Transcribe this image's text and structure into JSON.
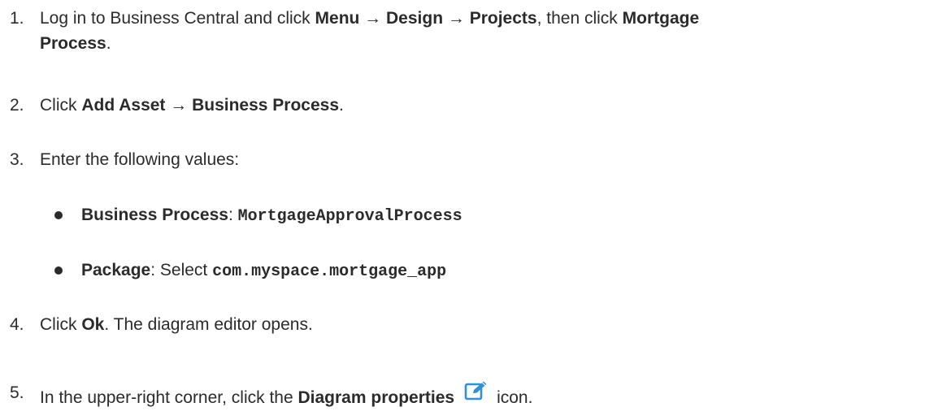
{
  "steps": [
    {
      "num": "1.",
      "text_a": "Log in to Business Central and click ",
      "menu": "Menu",
      "arrow1": " → ",
      "design": "Design",
      "arrow2": " → ",
      "projects": "Projects",
      "text_b": ", then click ",
      "mortgage": "Mortgage",
      "process": "Process",
      "text_c": "."
    },
    {
      "num": "2.",
      "text_a": "Click ",
      "add_asset": "Add Asset",
      "arrow": " → ",
      "business_process": "Business Process",
      "text_b": "."
    },
    {
      "num": "3.",
      "text_a": "Enter the following values:",
      "bullets": [
        {
          "label": "Business Process",
          "sep": ": ",
          "value": "MortgageApprovalProcess"
        },
        {
          "label": "Package",
          "sep": ": Select ",
          "value": "com.myspace.mortgage_app"
        }
      ]
    },
    {
      "num": "4.",
      "text_a": "Click ",
      "ok": "Ok",
      "text_b": ". The diagram editor opens."
    },
    {
      "num": "5.",
      "text_a": "In the upper-right corner, click the ",
      "diagram_properties": "Diagram properties",
      "icon_name": "edit-icon",
      "text_b": "icon."
    }
  ],
  "colors": {
    "text": "#2b2b2b",
    "icon": "#2f8fd8"
  }
}
